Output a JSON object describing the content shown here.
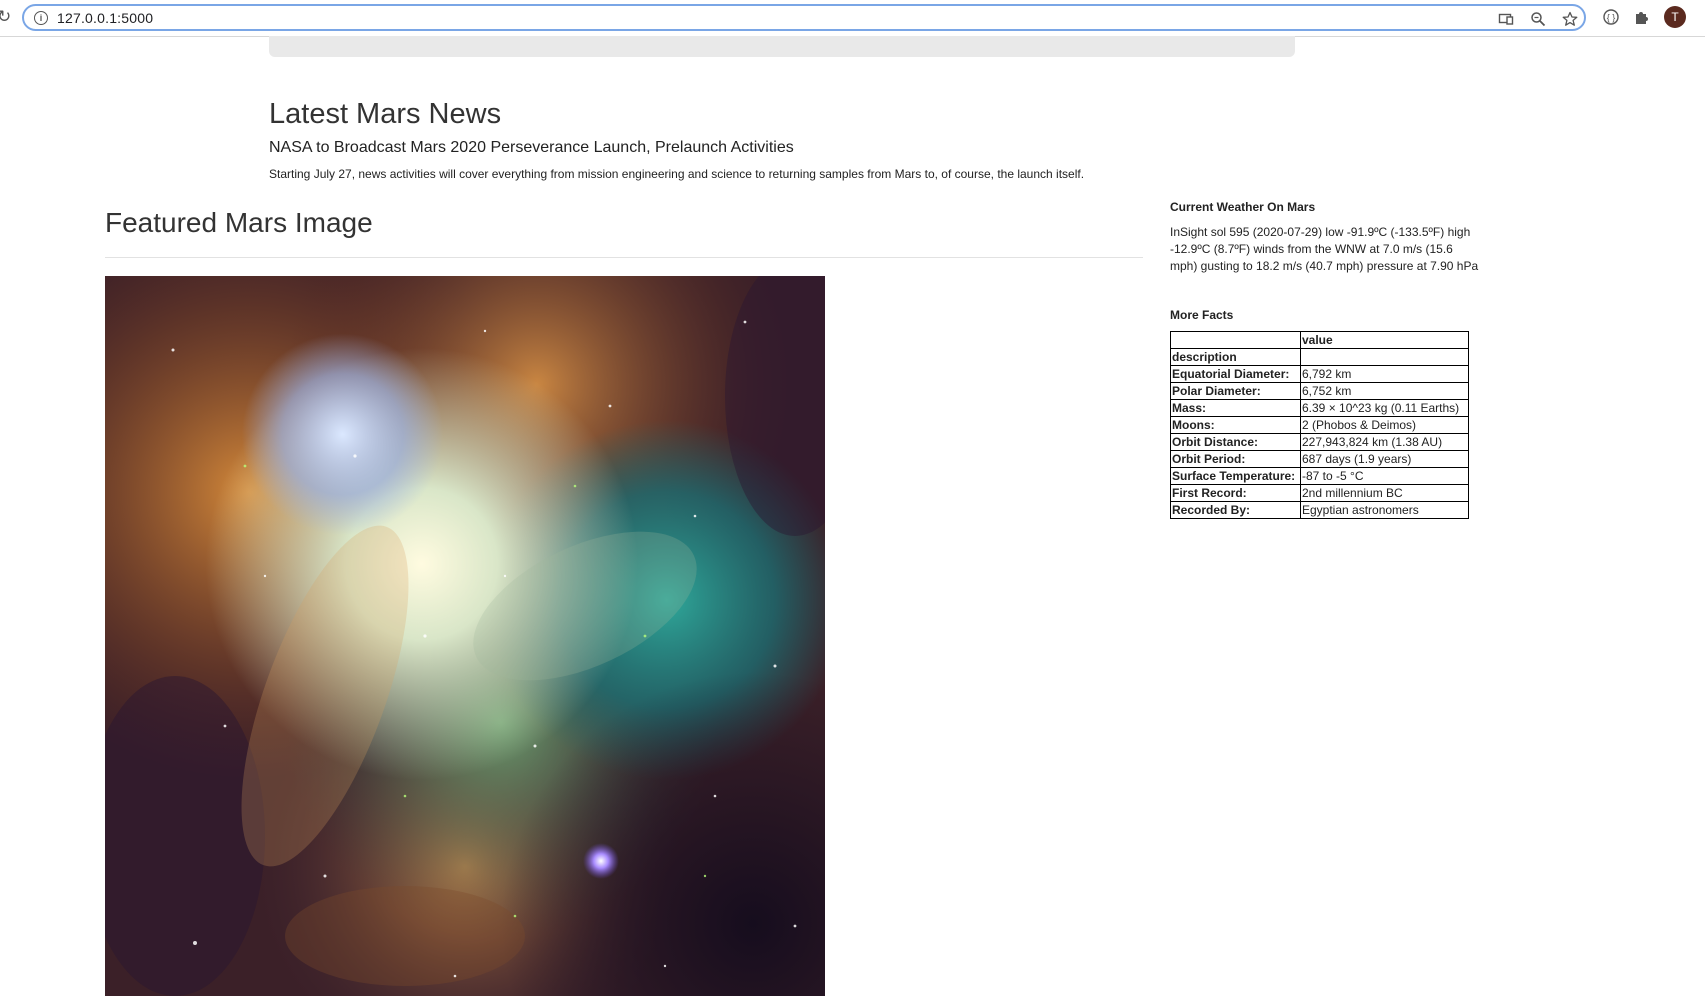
{
  "browser": {
    "url": "127.0.0.1:5000",
    "profile_initial": "T",
    "icons": [
      "reload-icon",
      "info-icon",
      "cast-icon",
      "zoom-icon",
      "bookmark-star-icon",
      "extension-icon",
      "puzzle-extension-icon"
    ]
  },
  "news": {
    "section_title": "Latest Mars News",
    "headline": "NASA to Broadcast Mars 2020 Perseverance Launch, Prelaunch Activities",
    "teaser": "Starting July 27, news activities will cover everything from mission engineering and science to returning samples from Mars to, of course, the launch itself."
  },
  "featured": {
    "title": "Featured Mars Image"
  },
  "weather": {
    "title": "Current Weather On Mars",
    "text": "InSight sol 595 (2020-07-29) low -91.9ºC (-133.5ºF) high -12.9ºC (8.7ºF) winds from the WNW at 7.0 m/s (15.6 mph) gusting to 18.2 m/s (40.7 mph) pressure at 7.90 hPa"
  },
  "facts": {
    "title": "More Facts",
    "value_header": "value",
    "index_header": "description",
    "rows": [
      {
        "label": "Equatorial Diameter:",
        "value": "6,792 km"
      },
      {
        "label": "Polar Diameter:",
        "value": "6,752 km"
      },
      {
        "label": "Mass:",
        "value": "6.39 × 10^23 kg (0.11 Earths)"
      },
      {
        "label": "Moons:",
        "value": "2 (Phobos & Deimos)"
      },
      {
        "label": "Orbit Distance:",
        "value": "227,943,824 km (1.38 AU)"
      },
      {
        "label": "Orbit Period:",
        "value": "687 days (1.9 years)"
      },
      {
        "label": "Surface Temperature:",
        "value": "-87 to -5 °C"
      },
      {
        "label": "First Record:",
        "value": "2nd millennium BC"
      },
      {
        "label": "Recorded By:",
        "value": "Egyptian astronomers"
      }
    ]
  }
}
